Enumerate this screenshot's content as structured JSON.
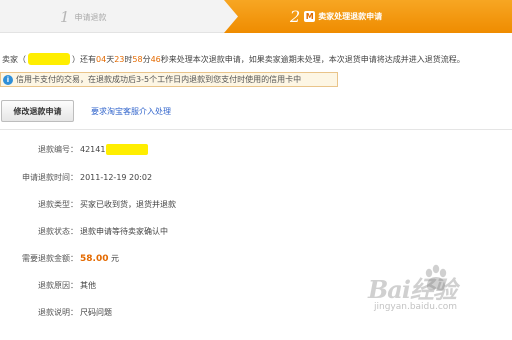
{
  "steps": {
    "step1": {
      "number": "1",
      "label": "申请退款"
    },
    "step2": {
      "number": "2",
      "label": "卖家处理退款申请"
    }
  },
  "countdown": {
    "prefix": "卖家（",
    "suffix": "）还有",
    "days": "04",
    "days_unit": "天",
    "hours": "23",
    "hours_unit": "时",
    "minutes": "58",
    "minutes_unit": "分",
    "seconds": "46",
    "tail": "秒来处理本次退款申请，如果卖家逾期未处理，本次退货申请将达成并进入退货流程。"
  },
  "notice": {
    "text": "信用卡支付的交易，在退款成功后3-5个工作日内退款到您支付时使用的信用卡中"
  },
  "actions": {
    "modify_label": "修改退款申请",
    "cs_link": "要求淘宝客服介入处理"
  },
  "details": {
    "refund_id": {
      "label": "退款编号：",
      "value": "42141"
    },
    "apply_time": {
      "label": "申请退款时间：",
      "value": "2011-12-19 20:02"
    },
    "type": {
      "label": "退款类型：",
      "value": "买家已收到货，退货并退款"
    },
    "status": {
      "label": "退款状态：",
      "value": "退款申请等待卖家确认中"
    },
    "amount": {
      "label": "需要退款金额：",
      "value": "58.00",
      "unit": "元"
    },
    "reason": {
      "label": "退款原因：",
      "value": "其他"
    },
    "explanation": {
      "label": "退款说明：",
      "value": "尺码问题"
    }
  },
  "watermark": {
    "text": "Bai经验",
    "url": "jingyan.baidu.com"
  },
  "colors": {
    "accent_orange": "#f29400",
    "highlight_yellow": "#ffee00",
    "link_blue": "#3366cc",
    "amount_orange": "#e46a00"
  }
}
